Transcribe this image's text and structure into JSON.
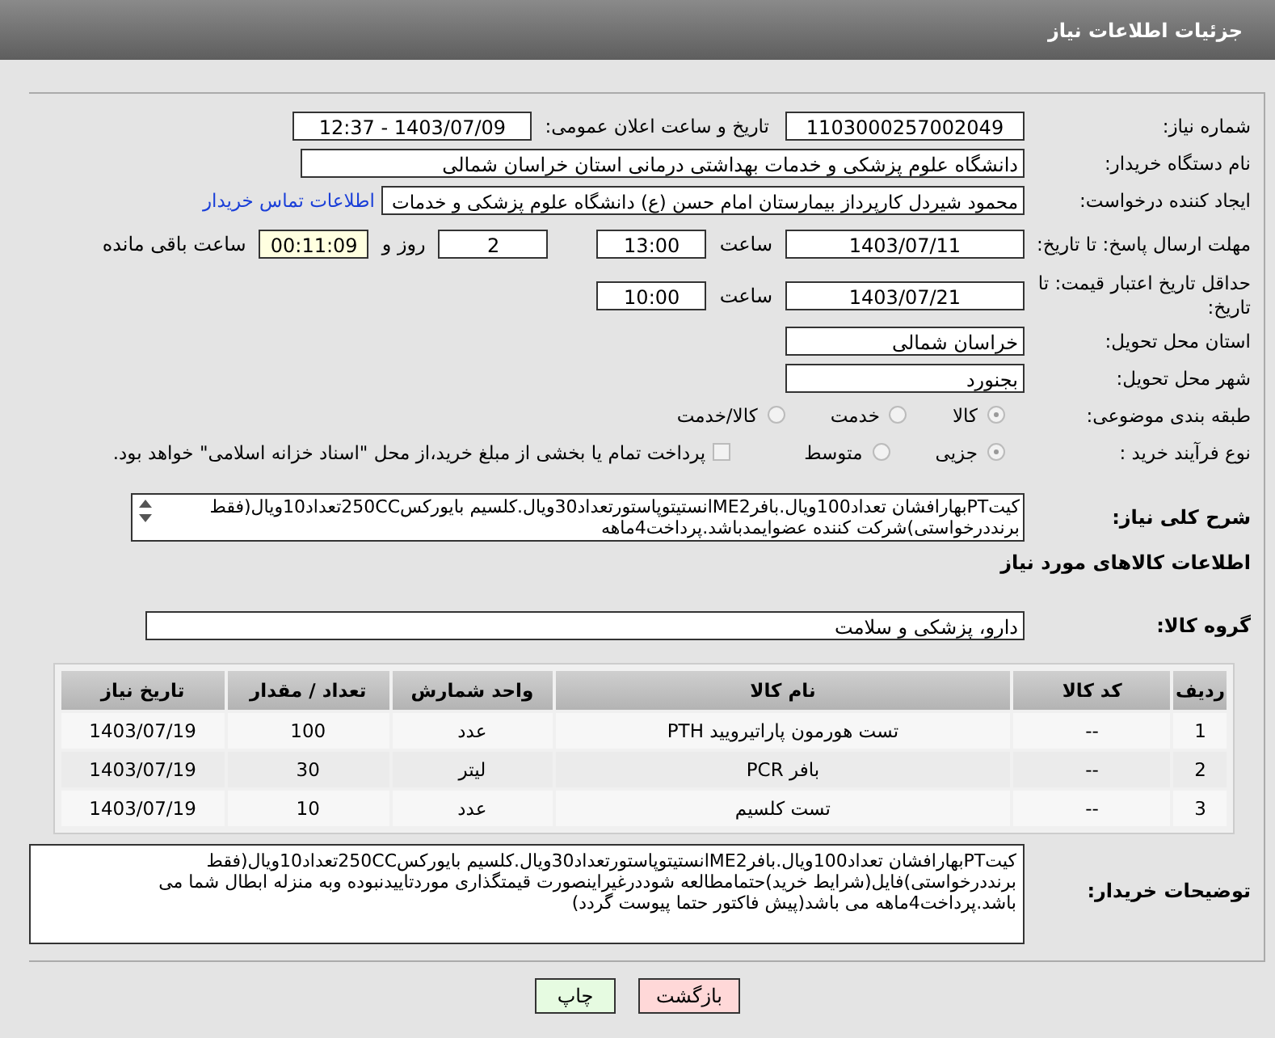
{
  "header": {
    "title": "جزئیات اطلاعات نیاز"
  },
  "need_number": {
    "label": "شماره نیاز:",
    "value": "1103000257002049"
  },
  "announce": {
    "label": "تاریخ و ساعت اعلان عمومی:",
    "value": "1403/07/09 - 12:37"
  },
  "buyer_org": {
    "label": "نام دستگاه خریدار:",
    "value": "دانشگاه علوم پزشکی و خدمات بهداشتی درمانی استان خراسان شمالی"
  },
  "requester": {
    "label": "ایجاد کننده درخواست:",
    "value": "محمود شیردل کارپرداز بیمارستان امام حسن (ع) دانشگاه علوم پزشکی و خدمات",
    "link": "اطلاعات تماس خریدار"
  },
  "reply_deadline": {
    "label": "مهلت ارسال پاسخ: تا تاریخ:",
    "date": "1403/07/11",
    "time_label": "ساعت",
    "time": "13:00",
    "days": "2",
    "days_label": "روز و",
    "remaining": "00:11:09",
    "remaining_label": "ساعت باقی مانده"
  },
  "price_validity": {
    "label": "حداقل تاریخ اعتبار قیمت: تا تاریخ:",
    "date": "1403/07/21",
    "time_label": "ساعت",
    "time": "10:00"
  },
  "delivery_province": {
    "label": "استان محل تحویل:",
    "value": "خراسان شمالی"
  },
  "delivery_city": {
    "label": "شهر محل تحویل:",
    "value": "بجنورد"
  },
  "category": {
    "label": "طبقه بندی موضوعی:",
    "options": [
      {
        "label": "کالا",
        "selected": true
      },
      {
        "label": "خدمت",
        "selected": false
      },
      {
        "label": "کالا/خدمت",
        "selected": false
      }
    ]
  },
  "process": {
    "label": "نوع فرآیند خرید :",
    "options": [
      {
        "label": "جزیی",
        "selected": true
      },
      {
        "label": "متوسط",
        "selected": false
      }
    ],
    "payment_checkbox": {
      "label": "پرداخت تمام یا بخشی از مبلغ خرید،از محل \"اسناد خزانه اسلامی\" خواهد بود.",
      "checked": false
    }
  },
  "description": {
    "label": "شرح کلی نیاز:",
    "value": "کیتPTبهارافشان تعداد100ویال.بافرME2انستیتوپاستورتعداد30ویال.کلسیم بایورکس250CCتعداد10ویال(فقط برنددرخواستی)شرکت کننده عضوایمدباشد.پرداخت4ماهه"
  },
  "goods_heading": "اطلاعات کالاهای مورد نیاز",
  "goods_group": {
    "label": "گروه کالا:",
    "value": "دارو، پزشکی و سلامت"
  },
  "table": {
    "columns": [
      "ردیف",
      "کد کالا",
      "نام کالا",
      "واحد شمارش",
      "تعداد / مقدار",
      "تاریخ نیاز"
    ],
    "rows": [
      [
        "1",
        "--",
        "تست هورمون پاراتیرویید PTH",
        "عدد",
        "100",
        "1403/07/19"
      ],
      [
        "2",
        "--",
        "بافر PCR",
        "لیتر",
        "30",
        "1403/07/19"
      ],
      [
        "3",
        "--",
        "تست کلسیم",
        "عدد",
        "10",
        "1403/07/19"
      ]
    ]
  },
  "buyer_notes": {
    "label": "توضیحات خریدار:",
    "value": "کیتPTبهارافشان تعداد100ویال.بافرME2انستیتوپاستورتعداد30ویال.کلسیم بایورکس250CCتعداد10ویال(فقط برنددرخواستی)فایل(شرایط خرید)حتمامطالعه شوددرغیراینصورت قیمتگذاری موردتاییدنبوده وبه منزله ابطال شما می باشد.پرداخت4ماهه می باشد(پیش فاکتور حتما پیوست گردد)"
  },
  "buttons": [
    {
      "label": "بازگشت",
      "kind": "back"
    },
    {
      "label": "چاپ",
      "kind": "print"
    }
  ]
}
